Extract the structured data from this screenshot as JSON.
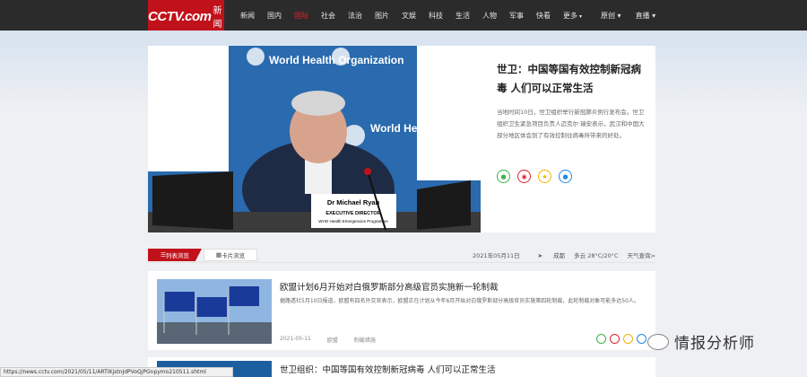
{
  "header": {
    "logo_text": "CCTV.com",
    "logo_sub": "新闻",
    "nav": [
      "新闻",
      "国内",
      "国际",
      "社会",
      "法治",
      "图片",
      "文娱",
      "科技",
      "生活",
      "人物",
      "军事",
      "快看",
      "更多"
    ],
    "active_index": 2,
    "right": [
      "原创",
      "直播"
    ]
  },
  "hero": {
    "title": "世卫：中国等国有效控制新冠病毒 人们可以正常生活",
    "desc": "当地时间10日，世卫组织举行新冠肺炎例行发布会。世卫组织卫生紧急项目负责人迈克尔·瑞安表示，武汉和中国大部分地区体会到了有效控制住病毒所带来的好处。",
    "image_banner": "World Health Organization",
    "name_plate_name": "Dr Michael Ryan",
    "name_plate_role": "EXECUTIVE DIRECTOR",
    "name_plate_org": "WHO Health Emergencies Programme"
  },
  "tabs": {
    "list_view": "列表浏览",
    "card_view": "卡片浏览",
    "date": "2021年05月11日",
    "location": "成都",
    "weather": "多云 28°C/20°C",
    "weather_link": "天气查询>"
  },
  "articles": [
    {
      "title": "欧盟计划6月开始对白俄罗斯部分高级官员实施新一轮制裁",
      "desc": "据路透社5月10日报道，欧盟有四名外交官表示，欧盟正在计划从今年6月开始对白俄罗斯部分高级官员实施第四轮制裁，此轮制裁对象可能多达50人。",
      "date": "2021-05-11",
      "tag1": "欧盟",
      "tag2": "制裁措施"
    },
    {
      "title": "世卫组织：中国等国有效控制新冠病毒 人们可以正常生活"
    }
  ],
  "statusbar": {
    "url": "https://news.cctv.com/2021/05/11/ARTIKjstnJdPVoQjPGnpymo210511.shtml"
  },
  "watermark": {
    "text": "情报分析师"
  },
  "colors": {
    "brand_red": "#c1121b",
    "topbar": "#2b2b2b"
  }
}
